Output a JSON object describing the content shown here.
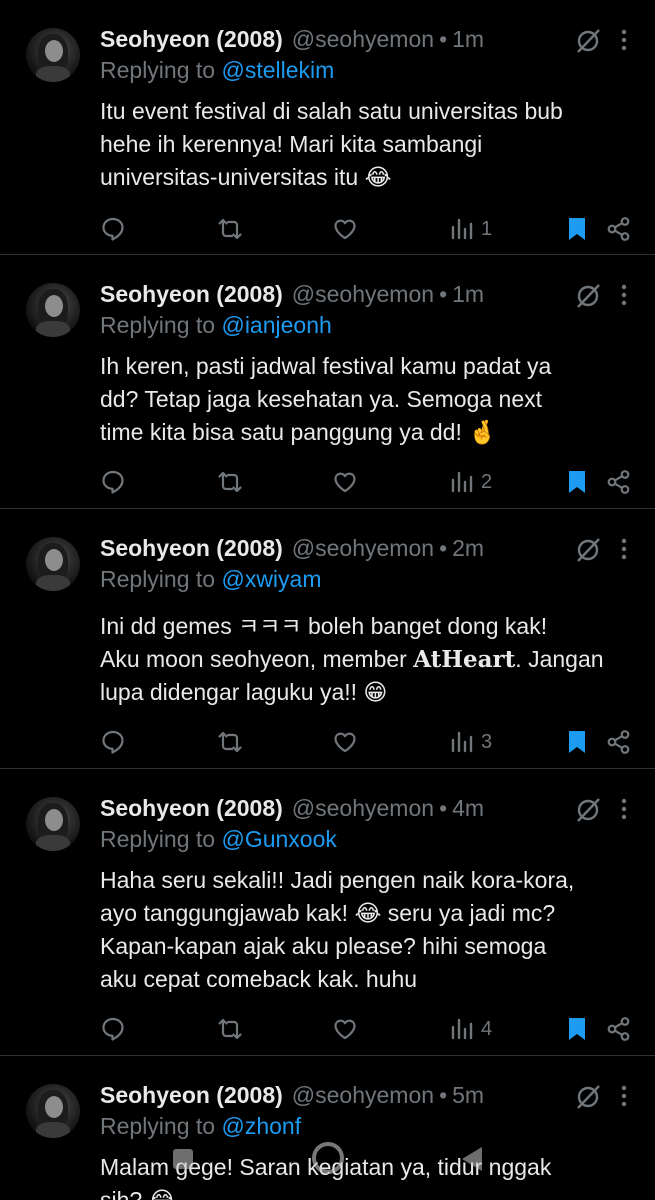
{
  "colors": {
    "background": "#000000",
    "text": "#e7e9ea",
    "muted": "#71767b",
    "accent": "#1d9bf0",
    "divider": "#2f3336"
  },
  "tweets": [
    {
      "name": "Seohyeon (2008)",
      "handle": "@seohyemon",
      "dot": "•",
      "time": "1m",
      "reply_prefix": "Replying to",
      "reply_to": "@stellekim",
      "line1": "Itu event festival di salah satu universitas bub",
      "line2": "hehe ih kerennya! Mari kita sambangi",
      "line3": "universitas-universitas itu 😂",
      "views": "1"
    },
    {
      "name": "Seohyeon (2008)",
      "handle": "@seohyemon",
      "dot": "•",
      "time": "1m",
      "reply_prefix": "Replying to",
      "reply_to": "@ianjeonh",
      "line1": "Ih keren, pasti jadwal festival kamu padat ya",
      "line2": "dd? Tetap jaga kesehatan ya. Semoga next",
      "line3": "time kita bisa satu panggung ya dd! 🤞",
      "views": "2"
    },
    {
      "name": "Seohyeon (2008)",
      "handle": "@seohyemon",
      "dot": "•",
      "time": "2m",
      "reply_prefix": "Replying to",
      "reply_to": "@xwiyam",
      "line1": "Ini dd gemes ㅋㅋㅋ boleh banget dong kak!",
      "line2_pre": "Aku moon seohyeon, member ",
      "line2_brand": "AtHeart",
      "line2_post": ". Jangan",
      "line3": "lupa didengar laguku ya!! 😁",
      "views": "3"
    },
    {
      "name": "Seohyeon (2008)",
      "handle": "@seohyemon",
      "dot": "•",
      "time": "4m",
      "reply_prefix": "Replying to",
      "reply_to": "@Gunxook",
      "line1": "Haha seru sekali!! Jadi pengen naik kora-kora,",
      "line2": "ayo tanggungjawab kak! 😂 seru ya jadi mc?",
      "line3": "Kapan-kapan ajak aku please? hihi semoga",
      "line4": "aku cepat comeback kak. huhu",
      "views": "4"
    },
    {
      "name": "Seohyeon (2008)",
      "handle": "@seohyemon",
      "dot": "•",
      "time": "5m",
      "reply_prefix": "Replying to",
      "reply_to": "@zhonf",
      "line1": "Malam gege! Saran kegiatan ya, tidur nggak",
      "line2": "sih? 😂"
    }
  ],
  "icons": {
    "reply": "reply-icon",
    "retweet": "retweet-icon",
    "like": "heart-icon",
    "views": "views-icon",
    "bookmark": "bookmark-icon",
    "share": "share-icon",
    "grok": "grok-icon",
    "more": "more-icon"
  }
}
